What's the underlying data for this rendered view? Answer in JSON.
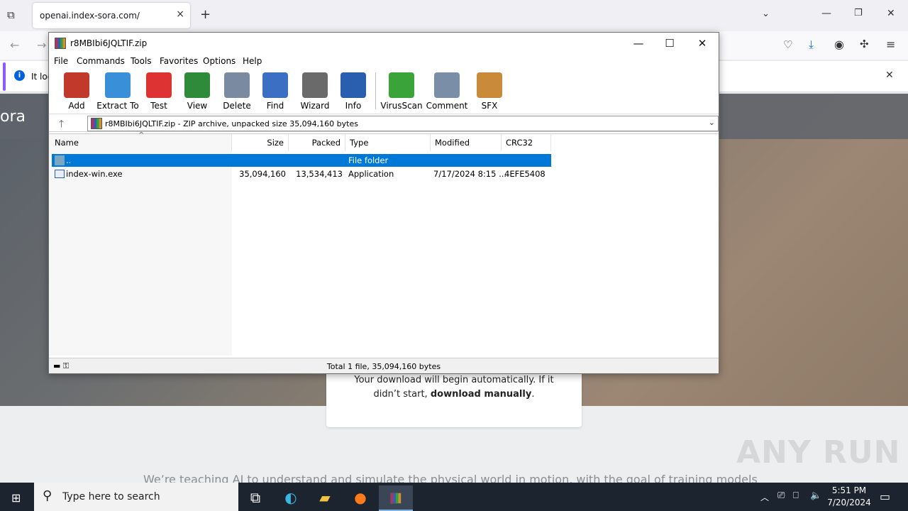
{
  "browser": {
    "tab_title": "openai.index-sora.com/",
    "tab_close": "×",
    "new_tab": "+",
    "infobar_text": "It loo"
  },
  "page": {
    "brand": "ora",
    "card_line1": "Your download will begin automatically. If it",
    "card_line2": "didn’t start,",
    "card_link": "download manually",
    "card_end": ".",
    "teaser": "We’re teaching AI to understand and simulate the physical world in motion, with the goal of training models"
  },
  "winrar": {
    "title": "r8MBIbi6JQLTIF.zip",
    "controls": {
      "minimize": "—",
      "maximize": "☐",
      "close": "✕"
    },
    "menu": [
      "File",
      "Commands",
      "Tools",
      "Favorites",
      "Options",
      "Help"
    ],
    "toolbar": [
      {
        "label": "Add",
        "icon": "add-icon",
        "color": "#c0392b"
      },
      {
        "label": "Extract To",
        "icon": "extract-icon",
        "color": "#3a8fd9"
      },
      {
        "label": "Test",
        "icon": "test-icon",
        "color": "#d33"
      },
      {
        "label": "View",
        "icon": "view-icon",
        "color": "#2e8b3a"
      },
      {
        "label": "Delete",
        "icon": "delete-icon",
        "color": "#7a8aa0"
      },
      {
        "label": "Find",
        "icon": "find-icon",
        "color": "#3b6fc4"
      },
      {
        "label": "Wizard",
        "icon": "wizard-icon",
        "color": "#6a6a6a"
      },
      {
        "label": "Info",
        "icon": "info-icon",
        "color": "#2a5fb0"
      },
      {
        "label": "VirusScan",
        "icon": "virusscan-icon",
        "color": "#3aa33a"
      },
      {
        "label": "Comment",
        "icon": "comment-icon",
        "color": "#7a8ea8"
      },
      {
        "label": "SFX",
        "icon": "sfx-icon",
        "color": "#c98a3a"
      }
    ],
    "address": "r8MBIbi6JQLTIF.zip - ZIP archive, unpacked size 35,094,160 bytes",
    "columns": [
      "Name",
      "Size",
      "Packed",
      "Type",
      "Modified",
      "CRC32"
    ],
    "rows": [
      {
        "name": "..",
        "size": "",
        "packed": "",
        "type": "File folder",
        "modified": "",
        "crc": ""
      },
      {
        "name": "index-win.exe",
        "size": "35,094,160",
        "packed": "13,534,413",
        "type": "Application",
        "modified": "7/17/2024 8:15 ...",
        "crc": "4EFE5408"
      }
    ],
    "status": "Total 1 file, 35,094,160 bytes"
  },
  "taskbar": {
    "search_placeholder": "Type here to search",
    "time": "5:51 PM",
    "date": "7/20/2024"
  },
  "watermark": "ANY RUN"
}
